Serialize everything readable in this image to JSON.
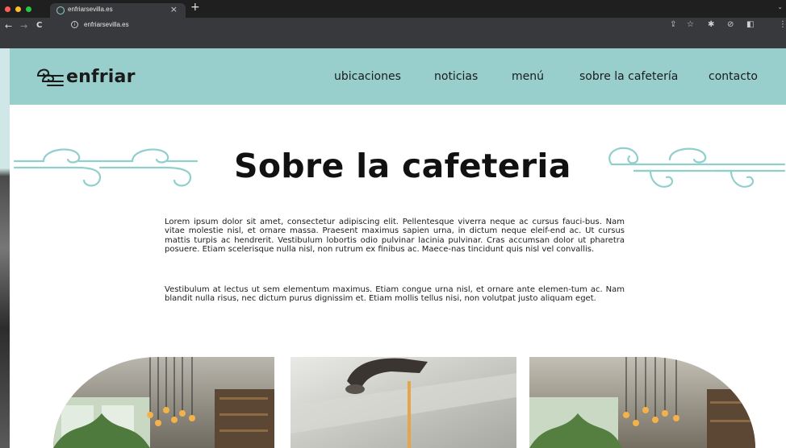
{
  "browser": {
    "tab_title": "enfriarsevilla.es",
    "tab_close": "×",
    "new_tab": "+",
    "url": "enfriarsevilla.es",
    "back": "←",
    "forward": "→",
    "reload": "C",
    "info": "i"
  },
  "site": {
    "brand": "enfriar",
    "nav": [
      "ubicaciones",
      "noticias",
      "menú",
      "sobre la cafetería",
      "contacto"
    ],
    "colors": {
      "header_bg": "#98cfcc",
      "wave_stroke": "#8fcfcc",
      "text": "#111111"
    }
  },
  "main": {
    "title": "Sobre la cafeteria",
    "paragraphs": [
      "Lorem ipsum dolor sit amet, consectetur adipiscing elit. Pellentesque viverra neque ac cursus fauci-bus. Nam vitae molestie nisl, et ornare massa. Praesent maximus sapien urna, in dictum neque eleif-end ac. Ut cursus mattis turpis ac hendrerit. Vestibulum lobortis odio pulvinar lacinia pulvinar. Cras accumsan dolor ut pharetra posuere. Etiam scelerisque nulla nisl, non rutrum ex finibus ac. Maece-nas tincidunt quis nisl vel convallis.",
      "Vestibulum at lectus ut sem elementum maximus. Etiam congue urna nisl, et ornare ante elemen-tum ac. Nam blandit nulla risus, nec dictum purus dignissim et. Etiam mollis tellus nisi, non volutpat justo aliquam eget."
    ]
  }
}
